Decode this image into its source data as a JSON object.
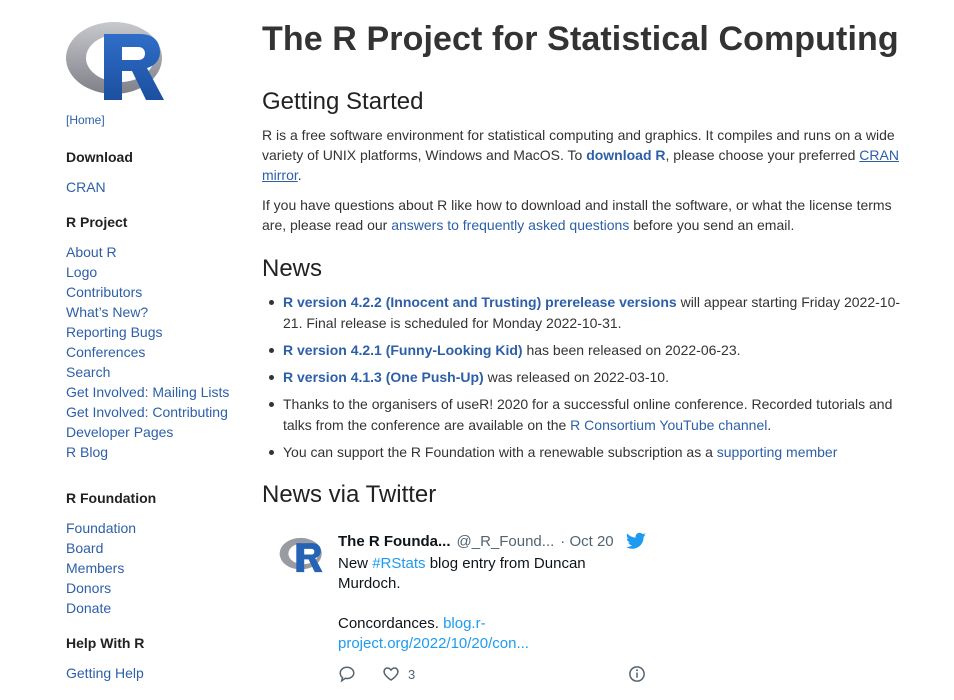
{
  "sidebar": {
    "home_label": "[Home]",
    "sections": [
      {
        "title": "Download",
        "items": [
          "CRAN"
        ]
      },
      {
        "title": "R Project",
        "items": [
          "About R",
          "Logo",
          "Contributors",
          "What’s New?",
          "Reporting Bugs",
          "Conferences",
          "Search",
          "Get Involved: Mailing Lists",
          "Get Involved: Contributing",
          "Developer Pages",
          "R Blog"
        ]
      },
      {
        "title": "R Foundation",
        "items": [
          "Foundation",
          "Board",
          "Members",
          "Donors",
          "Donate"
        ]
      },
      {
        "title": "Help With R",
        "items": [
          "Getting Help"
        ]
      }
    ]
  },
  "main": {
    "title": "The R Project for Statistical Computing",
    "getting_started": {
      "heading": "Getting Started",
      "p1_a": "R is a free software environment for statistical computing and graphics. It compiles and runs on a wide variety of UNIX platforms, Windows and MacOS. To ",
      "p1_link": "download R",
      "p1_b": ", please choose your preferred ",
      "p1_link2": "CRAN mirror",
      "p1_c": ".",
      "p2_a": "If you have questions about R like how to download and install the software, or what the license terms are, please read our ",
      "p2_link": "answers to frequently asked questions",
      "p2_b": " before you send an email."
    },
    "news": {
      "heading": "News",
      "items": [
        {
          "link": "R version 4.2.2 (Innocent and Trusting) prerelease versions",
          "text": " will appear starting Friday 2022-10-21. Final release is scheduled for Monday 2022-10-31."
        },
        {
          "link": "R version 4.2.1 (Funny-Looking Kid)",
          "text": " has been released on 2022-06-23."
        },
        {
          "link": "R version 4.1.3 (One Push-Up)",
          "text": " was released on 2022-03-10."
        },
        {
          "text": "Thanks to the organisers of useR! 2020 for a successful online conference. Recorded tutorials and talks from the conference are available on the ",
          "link2": "R Consortium YouTube channel",
          "text2": "."
        },
        {
          "text": "You can support the R Foundation with a renewable subscription as a ",
          "link2": "supporting member",
          "text2": ""
        }
      ]
    },
    "twitter": {
      "heading": "News via Twitter",
      "tweet": {
        "name": "The R Founda...",
        "handle": "@_R_Found...",
        "date": "· Oct 20",
        "text_a": "New ",
        "hashtag": "#RStats",
        "text_b": " blog entry from Duncan Murdoch.",
        "text_c": "Concordances. ",
        "link": "blog.r-project.org/2022/10/20/con...",
        "likes": "3"
      }
    }
  },
  "colors": {
    "link": "#2d5fa8",
    "twitter_blue": "#1d9bf0",
    "text": "#333333"
  }
}
